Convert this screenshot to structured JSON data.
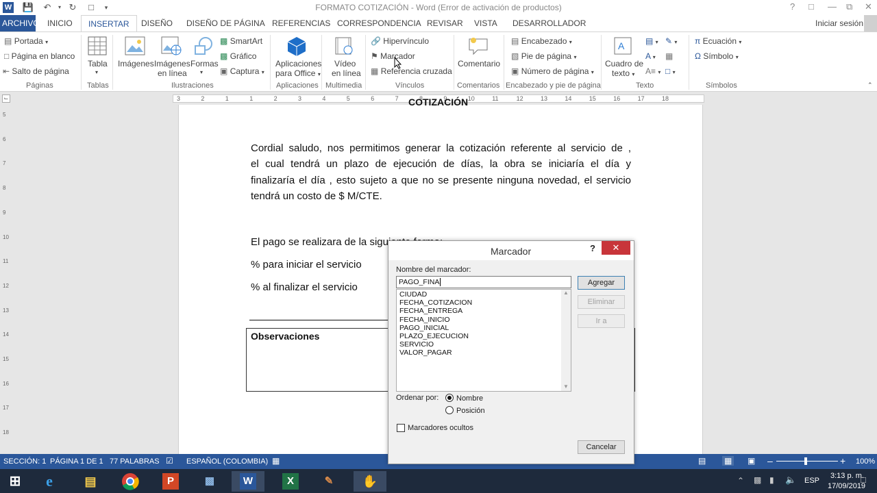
{
  "title": {
    "text": "FORMATO COTIZACIÓN - Word (Error de activación de productos)",
    "help": "?"
  },
  "tabs": {
    "archivo": "ARCHIVO",
    "items": [
      "INICIO",
      "INSERTAR",
      "DISEÑO",
      "DISEÑO DE PÁGINA",
      "REFERENCIAS",
      "CORRESPONDENCIA",
      "REVISAR",
      "VISTA",
      "DESARROLLADOR"
    ],
    "signin": "Iniciar sesión"
  },
  "ribbon": {
    "paginas": {
      "portada": "Portada",
      "en_blanco": "Página en blanco",
      "salto": "Salto de página",
      "group": "Páginas"
    },
    "tablas": {
      "tabla": "Tabla",
      "group": "Tablas"
    },
    "ilustraciones": {
      "imagenes": "Imágenes",
      "imagenes_linea_1": "Imágenes",
      "imagenes_linea_2": "en línea",
      "formas": "Formas",
      "smartart": "SmartArt",
      "grafico": "Gráfico",
      "captura": "Captura",
      "group": "Ilustraciones"
    },
    "aplicaciones": {
      "line1": "Aplicaciones",
      "line2": "para Office",
      "group": "Aplicaciones"
    },
    "multimedia": {
      "line1": "Vídeo",
      "line2": "en línea",
      "group": "Multimedia"
    },
    "vinculos": {
      "hipervinculo": "Hipervínculo",
      "marcador": "Marcador",
      "referencia": "Referencia cruzada",
      "group": "Vínculos"
    },
    "comentarios": {
      "comentario": "Comentario",
      "group": "Comentarios"
    },
    "encabezado": {
      "encabezado": "Encabezado",
      "pie": "Pie de página",
      "numero": "Número de página",
      "group": "Encabezado y pie de página"
    },
    "texto": {
      "line1": "Cuadro de",
      "line2": "texto",
      "group": "Texto"
    },
    "simbolos": {
      "ecuacion": "Ecuación",
      "simbolo": "Símbolo",
      "group": "Símbolos"
    }
  },
  "ruler": {
    "numbers": [
      "3",
      "2",
      "1",
      "1",
      "2",
      "3",
      "4",
      "5",
      "6",
      "7",
      "8",
      "9",
      "10",
      "11",
      "12",
      "13",
      "14",
      "15",
      "16",
      "17",
      "18"
    ],
    "vertical": [
      "5",
      "6",
      "7",
      "8",
      "9",
      "10",
      "11",
      "12",
      "13",
      "14",
      "15",
      "16",
      "17",
      "18"
    ]
  },
  "document": {
    "cut_heading": "COTIZACIÓN",
    "paragraph_lines": [
      "Cordial saludo, nos permitimos generar la cotización referente al servicio de  ,",
      "el cual tendrá un plazo de ejecución de  días, la obra se iniciaría el día  y",
      "finalizaría el día , esto sujeto a que no se presente ninguna novedad, el servicio",
      "tendrá un costo de  $ M/CTE."
    ],
    "payment": "El pago se realizara de la siguiente forma:",
    "start": " % para iniciar el servicio",
    "end": " % al finalizar el servicio",
    "observaciones": "Observaciones"
  },
  "dialog": {
    "title": "Marcador",
    "help": "?",
    "name_label": "Nombre del marcador:",
    "name_value": "PAGO_FINA",
    "bookmarks": [
      "CIUDAD",
      "FECHA_COTIZACION",
      "FECHA_ENTREGA",
      "FECHA_INICIO",
      "PAGO_INICIAL",
      "PLAZO_EJECUCION",
      "SERVICIO",
      "VALOR_PAGAR"
    ],
    "add": "Agregar",
    "delete": "Eliminar",
    "goto": "Ir a",
    "sort_label": "Ordenar por:",
    "sort_name": "Nombre",
    "sort_position": "Posición",
    "sort_selected": "Nombre",
    "hidden": "Marcadores ocultos",
    "hidden_checked": false,
    "cancel": "Cancelar"
  },
  "status": {
    "section": "SECCIÓN: 1",
    "page": "PÁGINA 1 DE 1",
    "words": "77 PALABRAS",
    "language": "ESPAÑOL (COLOMBIA)",
    "zoom": "100%"
  },
  "taskbar": {
    "lang": "ESP",
    "time": "3:13 p. m.",
    "date": "17/09/2019",
    "apps": [
      "start-icon",
      "internet-explorer-icon",
      "file-explorer-icon",
      "chrome-icon",
      "powerpoint-icon",
      "remote-desktop-icon",
      "word-icon",
      "excel-icon",
      "paint-icon",
      "media-app-icon"
    ]
  },
  "colors": {
    "word_blue": "#2b579a",
    "taskbar": "#1e2a3c",
    "close_red": "#c8353a"
  }
}
